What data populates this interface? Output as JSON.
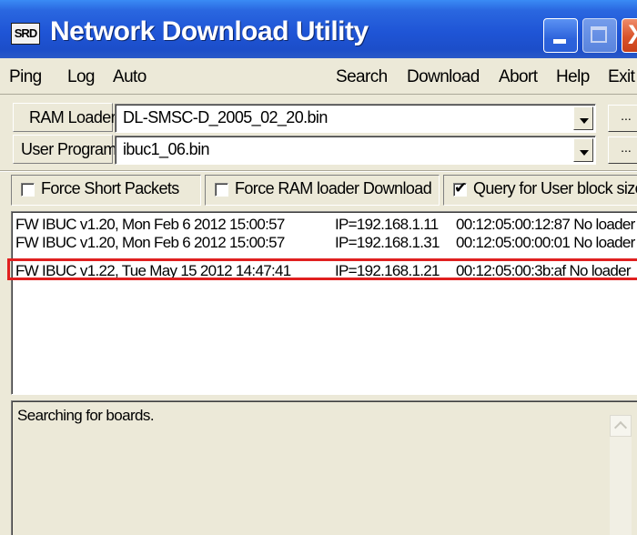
{
  "window": {
    "title": "Network Download Utility",
    "app_icon_text": "SRD",
    "controls": [
      "minimize",
      "maximize",
      "close"
    ],
    "close_glyph": "X"
  },
  "menu": {
    "ping": "Ping",
    "log": "Log",
    "auto": "Auto",
    "search": "Search",
    "download": "Download",
    "abort": "Abort",
    "help": "Help",
    "exit": "Exit"
  },
  "ram_loader": {
    "label": "RAM Loader:",
    "value": "DL-SMSC-D_2005_02_20.bin",
    "browse_label": "..."
  },
  "user_program": {
    "label": "User Program:",
    "value": "ibuc1_06.bin",
    "browse_label": "..."
  },
  "options": {
    "force_short_packets": {
      "label": "Force Short Packets",
      "checked": false
    },
    "force_ram_loader": {
      "label": "Force RAM loader Download",
      "checked": false
    },
    "query_user_block": {
      "label": "Query for User block size",
      "checked": true
    },
    "check_glyph": "✔"
  },
  "boards": [
    {
      "fw": "FW IBUC v1.20, Mon Feb  6 2012 15:00:57",
      "ip": "IP=192.168.1.11",
      "mac_status": "00:12:05:00:12:87 No loader"
    },
    {
      "fw": "FW IBUC v1.20, Mon Feb  6 2012 15:00:57",
      "ip": "IP=192.168.1.31",
      "mac_status": "00:12:05:00:00:01 No loader"
    },
    {
      "fw": "FW IBUC v1.22, Tue May 15 2012 14:47:41",
      "ip": "IP=192.168.1.21",
      "mac_status": "00:12:05:00:3b:af No loader"
    }
  ],
  "highlighted_row": 3,
  "log": {
    "text": "Searching for boards."
  },
  "colors": {
    "titlebar": "#1f55d6",
    "close_button": "#d9532a",
    "highlight_border": "#e02020",
    "window_face": "#ece9d8"
  }
}
